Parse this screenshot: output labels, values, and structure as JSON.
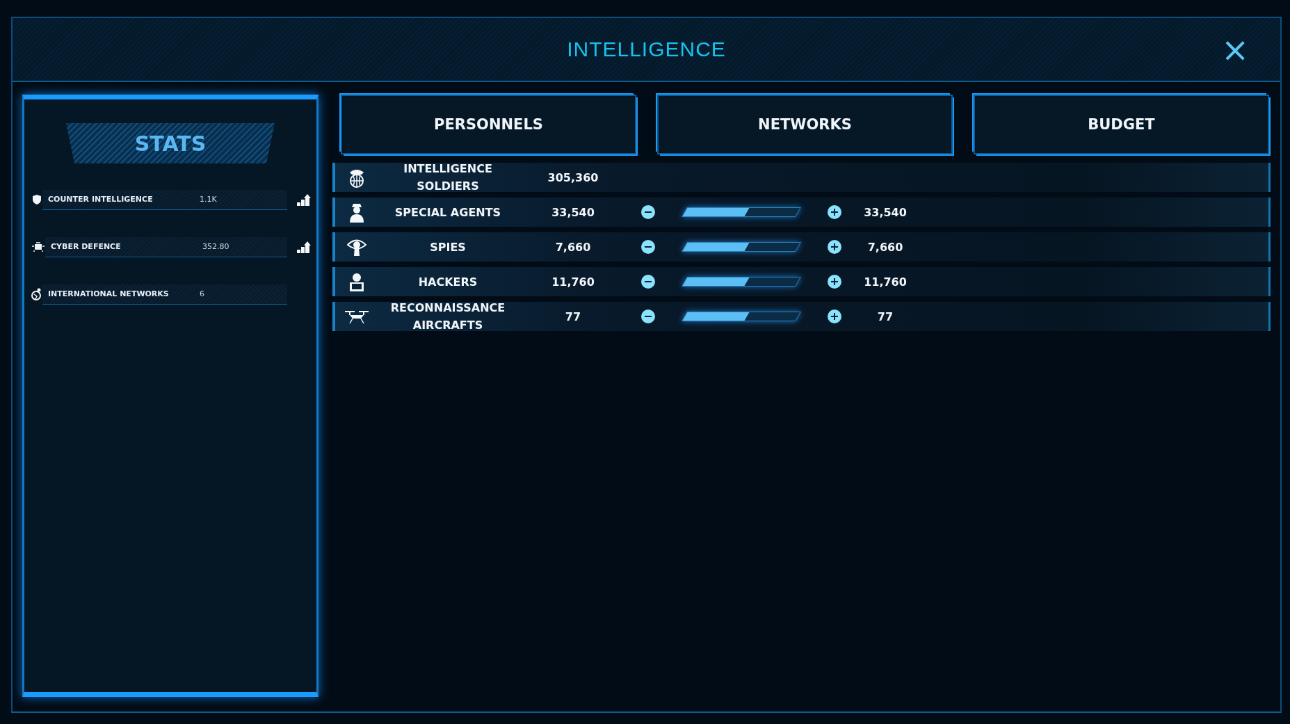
{
  "window": {
    "title": "INTELLIGENCE",
    "close": "×"
  },
  "stats": {
    "title": "STATS",
    "items": [
      {
        "label": "COUNTER INTELLIGENCE",
        "value": "1.1K",
        "kind": "upgradable"
      },
      {
        "label": "CYBER DEFENCE",
        "value": "352.80",
        "kind": "upgradable"
      },
      {
        "label": "INTERNATIONAL NETWORKS",
        "value": "6",
        "kind": "plain"
      }
    ]
  },
  "tabs": [
    {
      "label": "PERSONNELS"
    },
    {
      "label": "NETWORKS"
    },
    {
      "label": "BUDGET"
    }
  ],
  "rows": [
    {
      "name": "INTELLIGENCE SOLDIERS",
      "value": "305,360",
      "kind": "static"
    },
    {
      "name": "SPECIAL AGENTS",
      "value": "33,540",
      "kind": "adjustable",
      "level": 0.55,
      "target": "33,540"
    },
    {
      "name": "SPIES",
      "value": "7,660",
      "kind": "adjustable",
      "level": 0.55,
      "target": "7,660"
    },
    {
      "name": "HACKERS",
      "value": "11,760",
      "kind": "adjustable",
      "level": 0.55,
      "target": "11,760"
    },
    {
      "name": "RECONNAISSANCE AIRCRAFTS",
      "value": "77",
      "kind": "adjustable",
      "level": 0.55,
      "target": "77"
    }
  ]
}
